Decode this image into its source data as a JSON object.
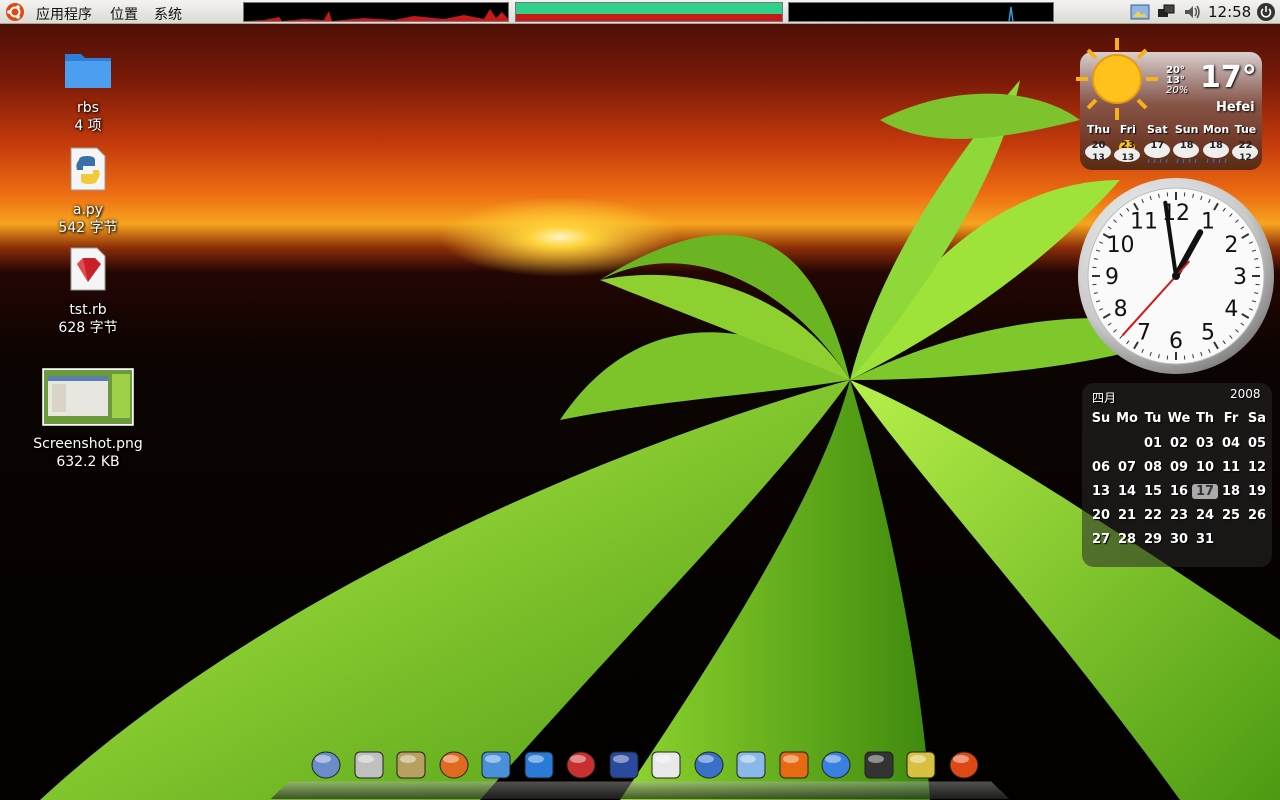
{
  "top_panel": {
    "menus": [
      "应用程序",
      "位置",
      "系统"
    ],
    "clock": "12:58"
  },
  "desktop_icons": [
    {
      "name": "rbs",
      "detail": "4 项",
      "icon": "folder-icon"
    },
    {
      "name": "a.py",
      "detail": "542 字节",
      "icon": "python-file-icon"
    },
    {
      "name": "tst.rb",
      "detail": "628 字节",
      "icon": "ruby-file-icon"
    },
    {
      "name": "Screenshot.png",
      "detail": "632.2 KB",
      "icon": "image-thumbnail-icon"
    }
  ],
  "weather": {
    "temperature": "17°",
    "high": "20°",
    "low": "13°",
    "humidity": "20%",
    "city": "Hefei",
    "forecast": [
      {
        "day": "Thu",
        "high": "20",
        "low": "13"
      },
      {
        "day": "Fri",
        "high": "23",
        "low": "13"
      },
      {
        "day": "Sat",
        "high": "17",
        "low": ""
      },
      {
        "day": "Sun",
        "high": "18",
        "low": ""
      },
      {
        "day": "Mon",
        "high": "18",
        "low": ""
      },
      {
        "day": "Tue",
        "high": "22",
        "low": "12"
      }
    ]
  },
  "analog_clock": {
    "numbers": [
      "12",
      "1",
      "2",
      "3",
      "4",
      "5",
      "6",
      "7",
      "8",
      "9",
      "10",
      "11"
    ],
    "hour": 12,
    "minute": 58,
    "second": 37
  },
  "calendar": {
    "month": "四月",
    "year": "2008",
    "weekdays": [
      "Su",
      "Mo",
      "Tu",
      "We",
      "Th",
      "Fr",
      "Sa"
    ],
    "first_weekday": 2,
    "days": [
      "01",
      "02",
      "03",
      "04",
      "05",
      "06",
      "07",
      "08",
      "09",
      "10",
      "11",
      "12",
      "13",
      "14",
      "15",
      "16",
      "17",
      "18",
      "19",
      "20",
      "21",
      "22",
      "23",
      "24",
      "25",
      "26",
      "27",
      "28",
      "29",
      "30",
      "31"
    ],
    "today": "17"
  },
  "dock": {
    "items": [
      "computer-icon",
      "graphics-app-icon",
      "speaker-app-icon",
      "fox-app-icon",
      "chat-app-icon",
      "media-player-icon",
      "help-book-icon",
      "globe-icon",
      "text-editor-icon",
      "network-globe-icon",
      "monitor-icon",
      "firefox-icon",
      "folder-icon",
      "terminal-icon",
      "drive-icon",
      "ubuntu-logo-icon"
    ]
  },
  "colors": {
    "panel": "#dcdad5",
    "monitor_green": "#2fd18a",
    "monitor_red": "#c81818",
    "calendar_today": "#dcdcdc"
  }
}
